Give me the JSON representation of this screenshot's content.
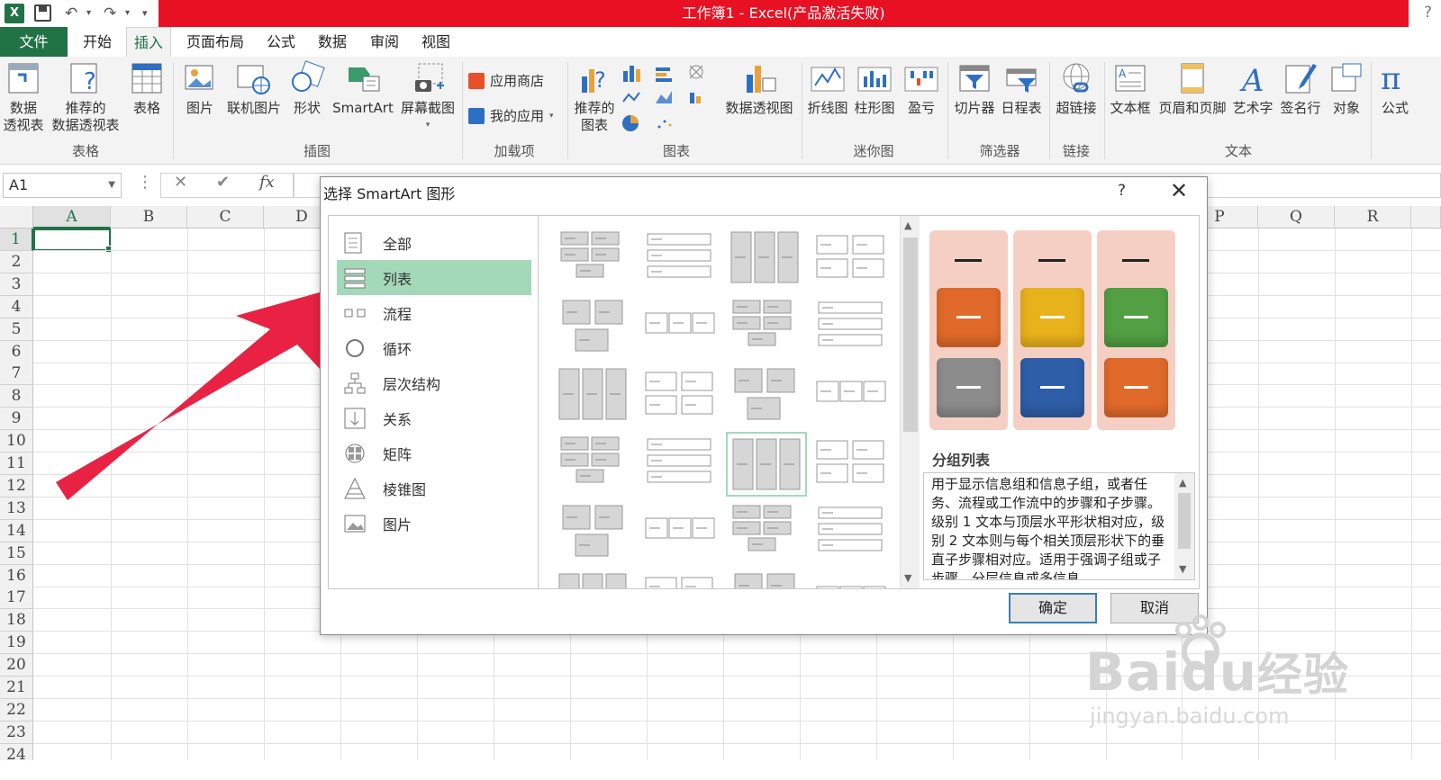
{
  "window": {
    "title": "工作簿1 -  Excel(产品激活失败)",
    "help": "?"
  },
  "menu": {
    "file": "文件",
    "tabs": [
      "开始",
      "插入",
      "页面布局",
      "公式",
      "数据",
      "审阅",
      "视图"
    ]
  },
  "ribbon": {
    "buttons": {
      "pivot": "数据\n透视表",
      "rec_pivot": "推荐的\n数据透视表",
      "table": "表格",
      "picture": "图片",
      "online_picture": "联机图片",
      "shapes": "形状",
      "smartart": "SmartArt",
      "screenshot": "屏幕截图",
      "store": "应用商店",
      "my_apps": "我的应用",
      "rec_charts": "推荐的\n图表",
      "pivot_chart": "数据透视图",
      "spark_line": "折线图",
      "spark_column": "柱形图",
      "spark_winloss": "盈亏",
      "slicer": "切片器",
      "timeline": "日程表",
      "hyperlink": "超链接",
      "textbox": "文本框",
      "header_footer": "页眉和页脚",
      "wordart": "艺术字",
      "signature": "签名行",
      "object": "对象",
      "equation": "公式"
    },
    "groups": [
      "表格",
      "插图",
      "加载项",
      "图表",
      "迷你图",
      "筛选器",
      "链接",
      "文本"
    ]
  },
  "formula": {
    "namebox": "A1",
    "fx": "fx",
    "cancel": "✕",
    "enter": "✔"
  },
  "sheet": {
    "columns": [
      "A",
      "B",
      "C",
      "D",
      "P",
      "Q",
      "R"
    ],
    "rows": [
      "1",
      "2",
      "3",
      "4",
      "5",
      "6",
      "7",
      "8",
      "9",
      "10",
      "11",
      "12",
      "13",
      "14",
      "15",
      "16",
      "17",
      "18",
      "19",
      "20",
      "21",
      "22",
      "23",
      "24"
    ]
  },
  "dialog": {
    "title": "选择 SmartArt 图形",
    "help": "?",
    "close": "✕",
    "categories": [
      "全部",
      "列表",
      "流程",
      "循环",
      "层次结构",
      "关系",
      "矩阵",
      "棱锥图",
      "图片"
    ],
    "selected_category": "列表",
    "preview_title": "分组列表",
    "preview_desc": "用于显示信息组和信息子组，或者任务、流程或工作流中的步骤和子步骤。级别 1 文本与顶层水平形状相对应，级别 2 文本则与每个相关顶层形状下的垂直子步骤相对应。适用于强调子组或子步骤、分层信息或多信息",
    "ok": "确定",
    "cancel": "取消",
    "preview_colors": [
      "#e06a2a",
      "#e8b21c",
      "#52a043",
      "#8c8c8c",
      "#2e5ea8",
      "#e06a2a"
    ]
  },
  "watermark": {
    "brand": "Bai",
    "brand2": "du",
    "cn": "经验",
    "url": "jingyan.baidu.com"
  }
}
